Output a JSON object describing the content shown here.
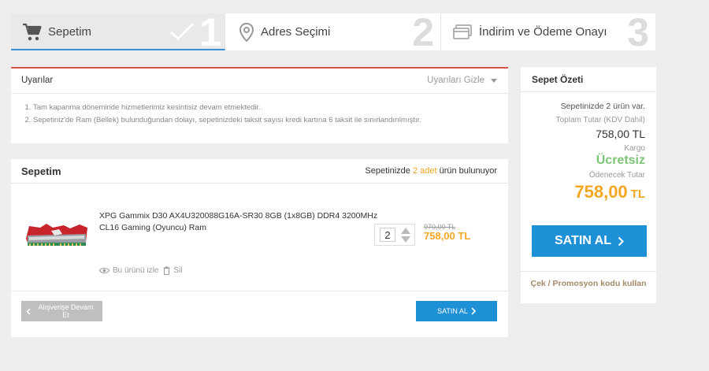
{
  "steps": [
    {
      "label": "Sepetim",
      "number": "1",
      "icon": "cart-icon"
    },
    {
      "label": "Adres Seçimi",
      "number": "2",
      "icon": "location-pin-icon"
    },
    {
      "label": "İndirim ve Ödeme Onayı",
      "number": "3",
      "icon": "card-icon"
    }
  ],
  "warnings": {
    "title": "Uyarılar",
    "hide_label": "Uyarıları Gizle",
    "items": [
      "Tam kapanma döneminde hizmetlerimiz kesintisiz devam etmektedir.",
      "Sepetiniz'de Ram (Bellek) bulunduğundan dolayı, sepetinizdeki taksit sayısı kredi kartına 6 taksit ile sınırlandırılmıştır."
    ]
  },
  "cart": {
    "title": "Sepetim",
    "info_prefix": "Sepetinizde",
    "info_count": "2 adet",
    "info_suffix": "ürün bulunuyor",
    "item": {
      "name": "XPG Gammix D30 AX4U320088G16A-SR30 8GB (1x8GB) DDR4 3200MHz CL16 Gaming (Oyuncu) Ram",
      "quantity": "2",
      "old_price": "970,00 TL",
      "price": "758,00 TL",
      "watch_label": "Bu ürünü izle",
      "delete_label": "Sil"
    },
    "back_label": "Alışverişe Devam Et",
    "buy_label": "SATIN AL"
  },
  "summary": {
    "title": "Sepet Özeti",
    "count_text": "Sepetinizde 2 ürün var.",
    "total_label": "Toplam Tutar (KDV Dahil)",
    "total": "758,00 TL",
    "shipping_label": "Kargo",
    "shipping": "Ücretsiz",
    "payable_label": "Ödenecek Tutar",
    "payable": "758,00",
    "payable_currency": "TL",
    "buy_label": "SATIN AL",
    "promo_label": "Çek / Promosyon kodu kullan"
  },
  "colors": {
    "accent_blue": "#1e90d6",
    "price_orange": "#f5a623",
    "free_green": "#7cc576",
    "warn_red": "#d9534f"
  }
}
